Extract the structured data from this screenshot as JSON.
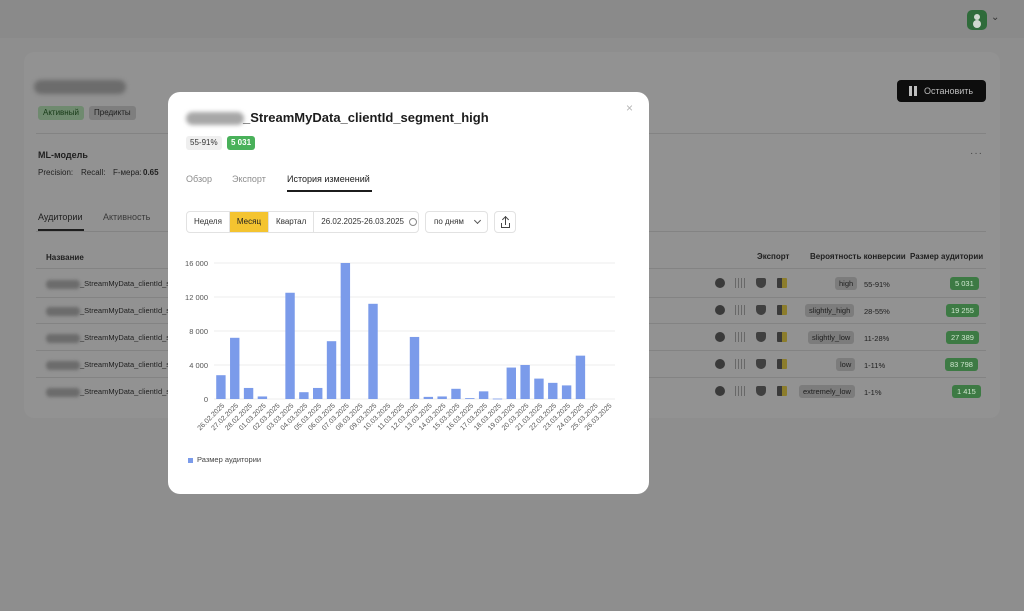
{
  "header": {
    "user_menu": {
      "avatar": "user-avatar-icon",
      "chevron": "⌄"
    }
  },
  "page": {
    "tags": [
      "Активный",
      "Предикты"
    ],
    "stop_button": "Остановить",
    "ml": {
      "title": "ML-модель",
      "precision": "Precision:",
      "recall": "Recall:",
      "fmeasure_label": "F-мера:",
      "fmeasure_value": "0.65"
    },
    "tabs": [
      "Аудитории",
      "Активность"
    ],
    "table": {
      "headers": {
        "name": "Название",
        "export": "Экспорт",
        "probability": "Вероятность конверсии",
        "size": "Размер аудитории"
      },
      "rows": [
        {
          "name": "_StreamMyData_clientId_s",
          "probability": "high",
          "range": "55-91%",
          "size": "5 031"
        },
        {
          "name": "_StreamMyData_clientId_s",
          "probability": "slightly_high",
          "range": "28-55%",
          "size": "19 255"
        },
        {
          "name": "_StreamMyData_clientId_s",
          "probability": "slightly_low",
          "range": "11-28%",
          "size": "27 389"
        },
        {
          "name": "_StreamMyData_clientId_s",
          "probability": "low",
          "range": "1-11%",
          "size": "83 798"
        },
        {
          "name": "_StreamMyData_clientId_s",
          "probability": "extremely_low",
          "range": "1-1%",
          "size": "1 415"
        }
      ]
    }
  },
  "modal": {
    "title": "_StreamMyData_clientId_segment_high",
    "range_badge": "55-91%",
    "size_badge": "5 031",
    "tabs": [
      "Обзор",
      "Экспорт",
      "История изменений"
    ],
    "periods": [
      "Неделя",
      "Месяц",
      "Квартал"
    ],
    "date_range": "26.02.2025-26.03.2025",
    "granularity": "по дням",
    "close": "×"
  },
  "colors": {
    "bar": "#7b9bea",
    "accent": "#f4c430",
    "badge_green": "#49b15a"
  },
  "chart_data": {
    "type": "bar",
    "categories": [
      "26.02.2025",
      "27.02.2025",
      "28.02.2025",
      "01.03.2025",
      "02.03.2025",
      "03.03.2025",
      "04.03.2025",
      "05.03.2025",
      "06.03.2025",
      "07.03.2025",
      "08.03.2025",
      "09.03.2025",
      "10.03.2025",
      "11.03.2025",
      "12.03.2025",
      "13.03.2025",
      "14.03.2025",
      "15.03.2025",
      "16.03.2025",
      "17.03.2025",
      "18.03.2025",
      "19.03.2025",
      "20.03.2025",
      "21.03.2025",
      "22.03.2025",
      "23.03.2025",
      "24.03.2025",
      "25.03.2025",
      "26.03.2025"
    ],
    "series": [
      {
        "name": "Размер аудитории",
        "values": [
          2800,
          7200,
          1300,
          300,
          0,
          12500,
          800,
          1300,
          6800,
          16000,
          0,
          11200,
          0,
          0,
          7300,
          250,
          300,
          1200,
          100,
          900,
          50,
          3700,
          4000,
          2400,
          1900,
          1600,
          5100,
          0,
          0
        ]
      }
    ],
    "yticks": [
      "0",
      "4 000",
      "8 000",
      "12 000",
      "16 000"
    ],
    "ylim": [
      0,
      16000
    ],
    "grid": true,
    "legend": "bottom-left"
  }
}
